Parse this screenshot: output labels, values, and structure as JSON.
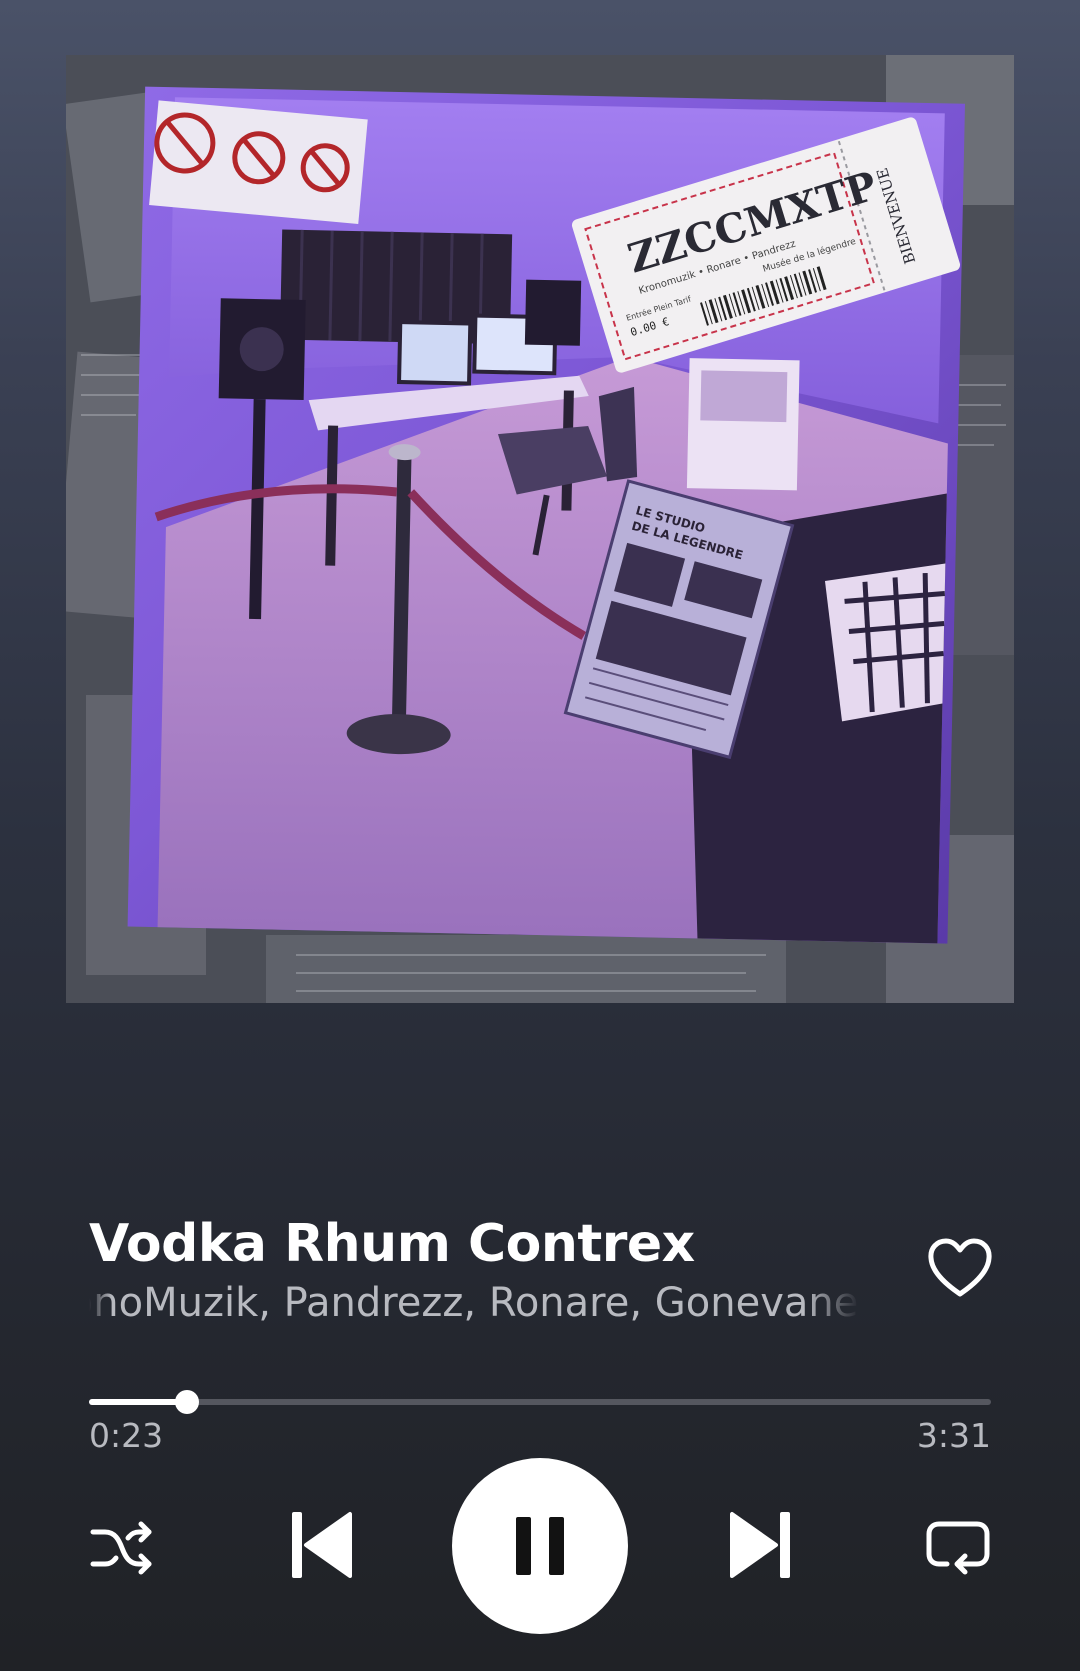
{
  "album": {
    "cover_title": "ZZCCMXTP",
    "ticket_credits": "Kronomuzik • Ronare • Pandrezz",
    "ticket_venue": "Musée de la légendre",
    "ticket_price_label": "Entrée Plein Tarif",
    "ticket_price": "0.00 €",
    "ticket_welcome": "BIENVENUE",
    "plaque_text": "LE STUDIO DE LA LEGENDRE"
  },
  "track": {
    "title": "Vodka Rhum Contrex",
    "artists": "KronoMuzik, Pandrezz, Ronare, Gonevane"
  },
  "progress": {
    "elapsed": "0:23",
    "total": "3:31",
    "fraction": 0.109
  },
  "controls": {
    "state": "playing",
    "icons": [
      "shuffle-icon",
      "skip-previous-icon",
      "pause-icon",
      "skip-next-icon",
      "repeat-icon",
      "heart-icon"
    ]
  },
  "colors": {
    "background_top": "#4a5268",
    "background_bottom": "#202226",
    "accent": "#ffffff",
    "secondary_text": "#b8bac0",
    "progress_track": "#55575f"
  }
}
